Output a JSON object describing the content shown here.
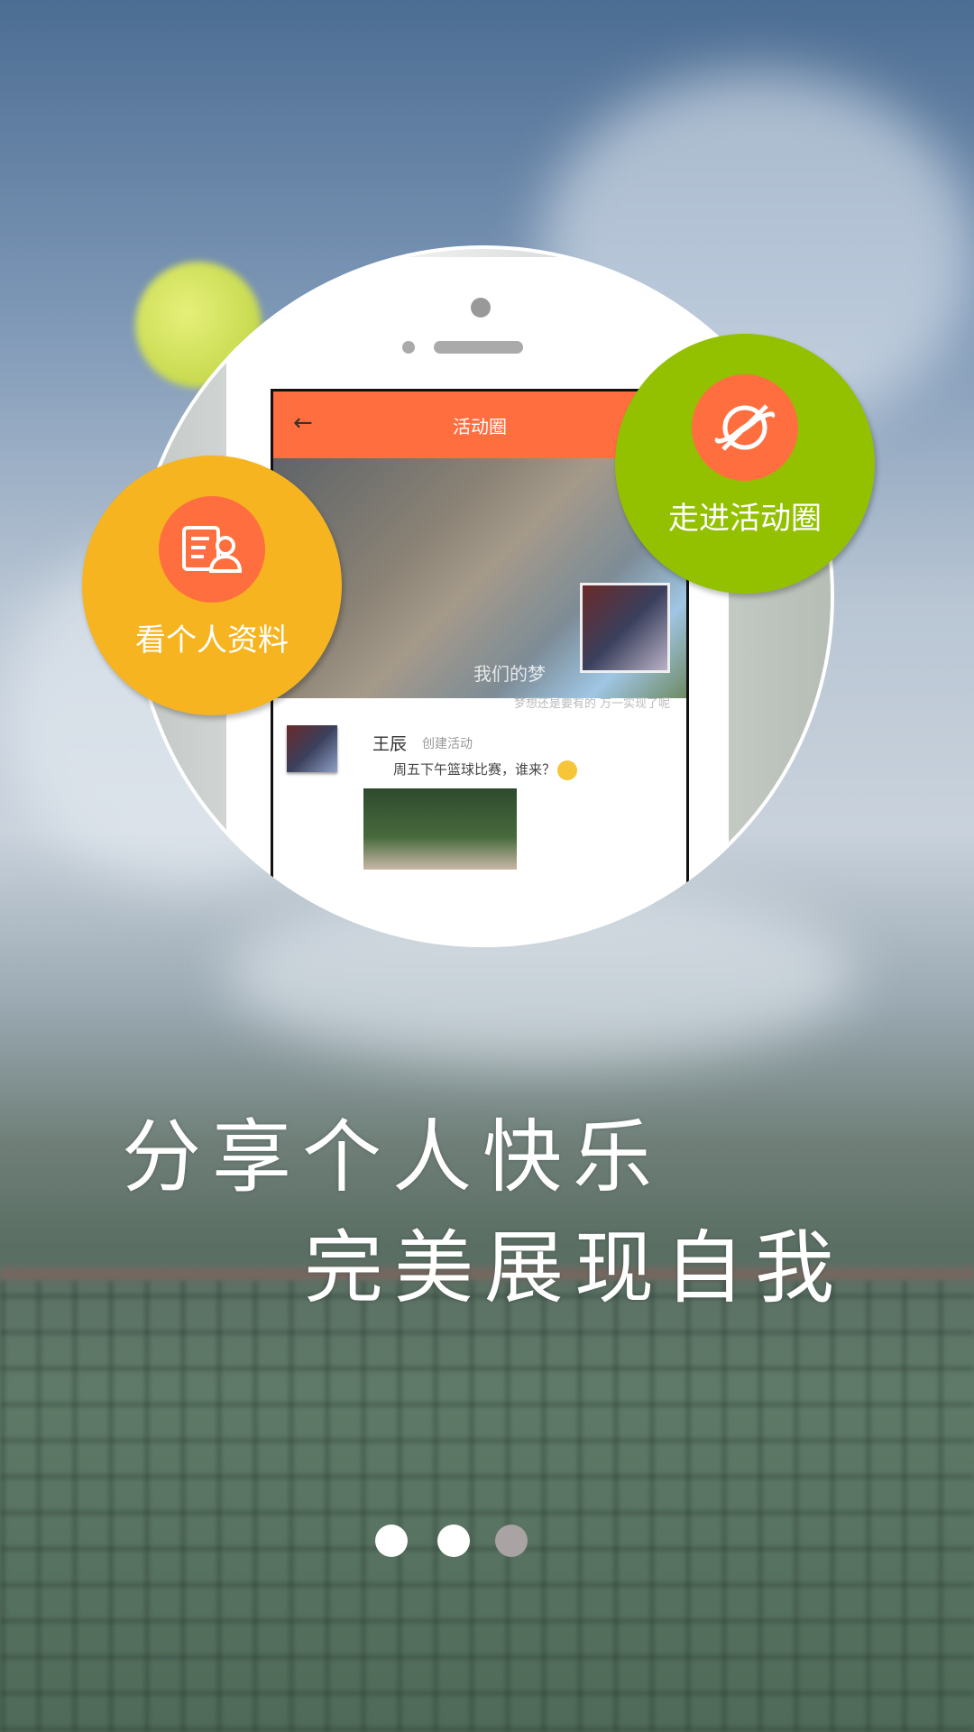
{
  "phone": {
    "header_title": "活动圈",
    "hero_caption": "我们的梦",
    "quote": "梦想还是要有的 万一实现了呢",
    "post": {
      "name": "王辰",
      "action": "创建活动",
      "text": "周五下午篮球比赛，谁来？"
    }
  },
  "bubbles": {
    "profile_label": "看个人资料",
    "activity_label": "走进活动圈"
  },
  "slogan": {
    "line1": "分享个人快乐",
    "line2": "完美展现自我"
  },
  "pager": {
    "total": 3,
    "active_index": 2
  }
}
